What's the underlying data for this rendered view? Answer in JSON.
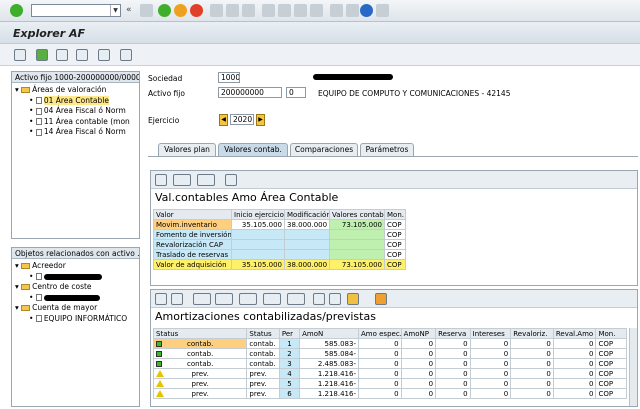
{
  "window": {
    "title": "Explorer AF"
  },
  "left_tree": {
    "header": "Activo fijo 1000-200000000/0000",
    "root": "Áreas de valoración",
    "items": [
      "01 Área Contable",
      "04 Área Fiscal ó Norm",
      "11 Área contable (mon",
      "14 Área Fiscal ó Norm"
    ]
  },
  "related": {
    "header": "Objetos relacionados con activo ...",
    "acreedor": "Acreedor",
    "centro": "Centro de coste",
    "cuenta": "Cuenta de mayor",
    "cuenta_item": "EQUIPO INFORMÁTICO"
  },
  "form": {
    "sociedad_label": "Sociedad",
    "sociedad": "1000",
    "activo_label": "Activo fijo",
    "activo": "200000000",
    "subnumero": "0",
    "activo_desc": "EQUIPO DE COMPUTO Y COMUNICACIONES - 42145",
    "ejercicio_label": "Ejercicio",
    "ejercicio": "2020"
  },
  "tabs": [
    "Valores plan",
    "Valores contab.",
    "Comparaciones",
    "Parámetros"
  ],
  "values_table": {
    "title": "Val.contables Amo Área Contable",
    "headers": [
      "Valor",
      "Inicio ejercicio",
      "Modificación",
      "Valores contab.",
      "Mon."
    ],
    "rows": [
      [
        "Movim.inventario",
        "35.105.000",
        "38.000.000",
        "73.105.000",
        "COP"
      ],
      [
        "Fomento de inversión",
        "",
        "",
        "",
        "COP"
      ],
      [
        "Revalorización CAP",
        "",
        "",
        "",
        "COP"
      ],
      [
        "Traslado de reservas",
        "",
        "",
        "",
        "COP"
      ],
      [
        "Valor de adquisición",
        "35.105.000",
        "38.000.000",
        "73.105.000",
        "COP"
      ]
    ]
  },
  "amort_table": {
    "title": "Amortizaciones contabilizadas/previstas",
    "headers": [
      "Status",
      "Status",
      "Per",
      "AmoN",
      "Amo espec.",
      "AmoNP",
      "Reserva",
      "Intereses",
      "Revaloriz.",
      "Reval.Amo",
      "Mon."
    ],
    "rows": [
      [
        "contab.",
        "contab.",
        "1",
        "585.083-",
        "0",
        "0",
        "0",
        "0",
        "0",
        "0",
        "COP"
      ],
      [
        "contab.",
        "contab.",
        "2",
        "585.084-",
        "0",
        "0",
        "0",
        "0",
        "0",
        "0",
        "COP"
      ],
      [
        "contab.",
        "contab.",
        "3",
        "2.485.083-",
        "0",
        "0",
        "0",
        "0",
        "0",
        "0",
        "COP"
      ],
      [
        "prev.",
        "prev.",
        "4",
        "1.218.416-",
        "0",
        "0",
        "0",
        "0",
        "0",
        "0",
        "COP"
      ],
      [
        "prev.",
        "prev.",
        "5",
        "1.218.416-",
        "0",
        "0",
        "0",
        "0",
        "0",
        "0",
        "COP"
      ],
      [
        "prev.",
        "prev.",
        "6",
        "1.218.416-",
        "0",
        "0",
        "0",
        "0",
        "0",
        "0",
        "COP"
      ]
    ]
  },
  "colors": {
    "accent": "#c9dbe8",
    "selected": "#ffe88a",
    "ok": "#3cb828",
    "warn": "#e7c400"
  }
}
